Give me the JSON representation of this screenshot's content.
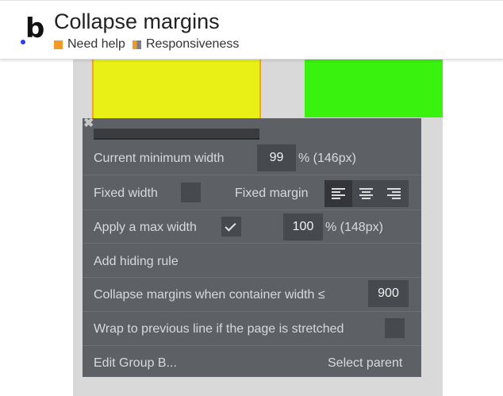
{
  "header": {
    "title": "Collapse margins",
    "links": [
      {
        "label": "Need help",
        "icon": "orange-square-icon"
      },
      {
        "label": "Responsiveness",
        "icon": "split-square-icon"
      }
    ]
  },
  "colors": {
    "yellow_element": "#e9f015",
    "green_element": "#39f20e",
    "panel_bg": "#5d6064",
    "accent_orange": "#f19a26"
  },
  "panel": {
    "min_width": {
      "label": "Current minimum width",
      "value": "99",
      "unit": "% (146px)"
    },
    "fixed": {
      "width_label": "Fixed width",
      "margin_label": "Fixed margin",
      "alignment_options": [
        "left",
        "center",
        "right"
      ],
      "selected_alignment": "left"
    },
    "max_width": {
      "label": "Apply a max width",
      "value": "100",
      "unit": "% (148px)",
      "checked": true
    },
    "hiding_rule": {
      "label": "Add hiding rule"
    },
    "collapse": {
      "label": "Collapse margins when container width ≤",
      "value": "900"
    },
    "wrap": {
      "label": "Wrap to previous line if the page is stretched",
      "checked": false
    },
    "footer": {
      "edit_label": "Edit Group B...",
      "parent_label": "Select parent"
    }
  }
}
